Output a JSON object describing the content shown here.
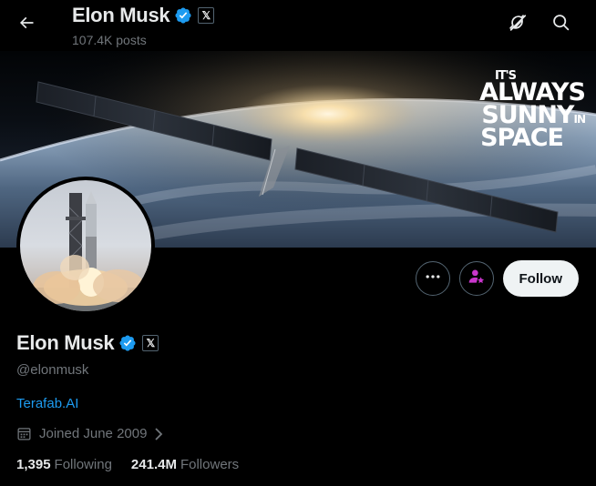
{
  "header": {
    "title": "Elon Musk",
    "posts_count": "107.4K posts",
    "back_icon": "arrow-left-icon",
    "grok_icon": "grok-icon",
    "search_icon": "search-icon"
  },
  "banner": {
    "text_line1": "IT'S",
    "text_line2": "ALWAYS",
    "text_line3": "SUNNY",
    "text_in": "IN",
    "text_line4": "SPACE"
  },
  "actions": {
    "more_icon": "more-horizontal-icon",
    "subscribe_icon": "person-star-icon",
    "follow_label": "Follow"
  },
  "profile": {
    "name": "Elon Musk",
    "handle": "@elonmusk",
    "link": "Terafab.AI",
    "joined": "Joined June 2009",
    "following_count": "1,395",
    "following_label": "Following",
    "followers_count": "241.4M",
    "followers_label": "Followers",
    "affiliate_badge": "𝕏"
  },
  "colors": {
    "background": "#000000",
    "text_primary": "#e7e9ea",
    "text_secondary": "#71767b",
    "link": "#1d9bf0",
    "verified": "#1d9bf0",
    "subscribe": "#c936cc",
    "follow_bg": "#eff3f4"
  }
}
